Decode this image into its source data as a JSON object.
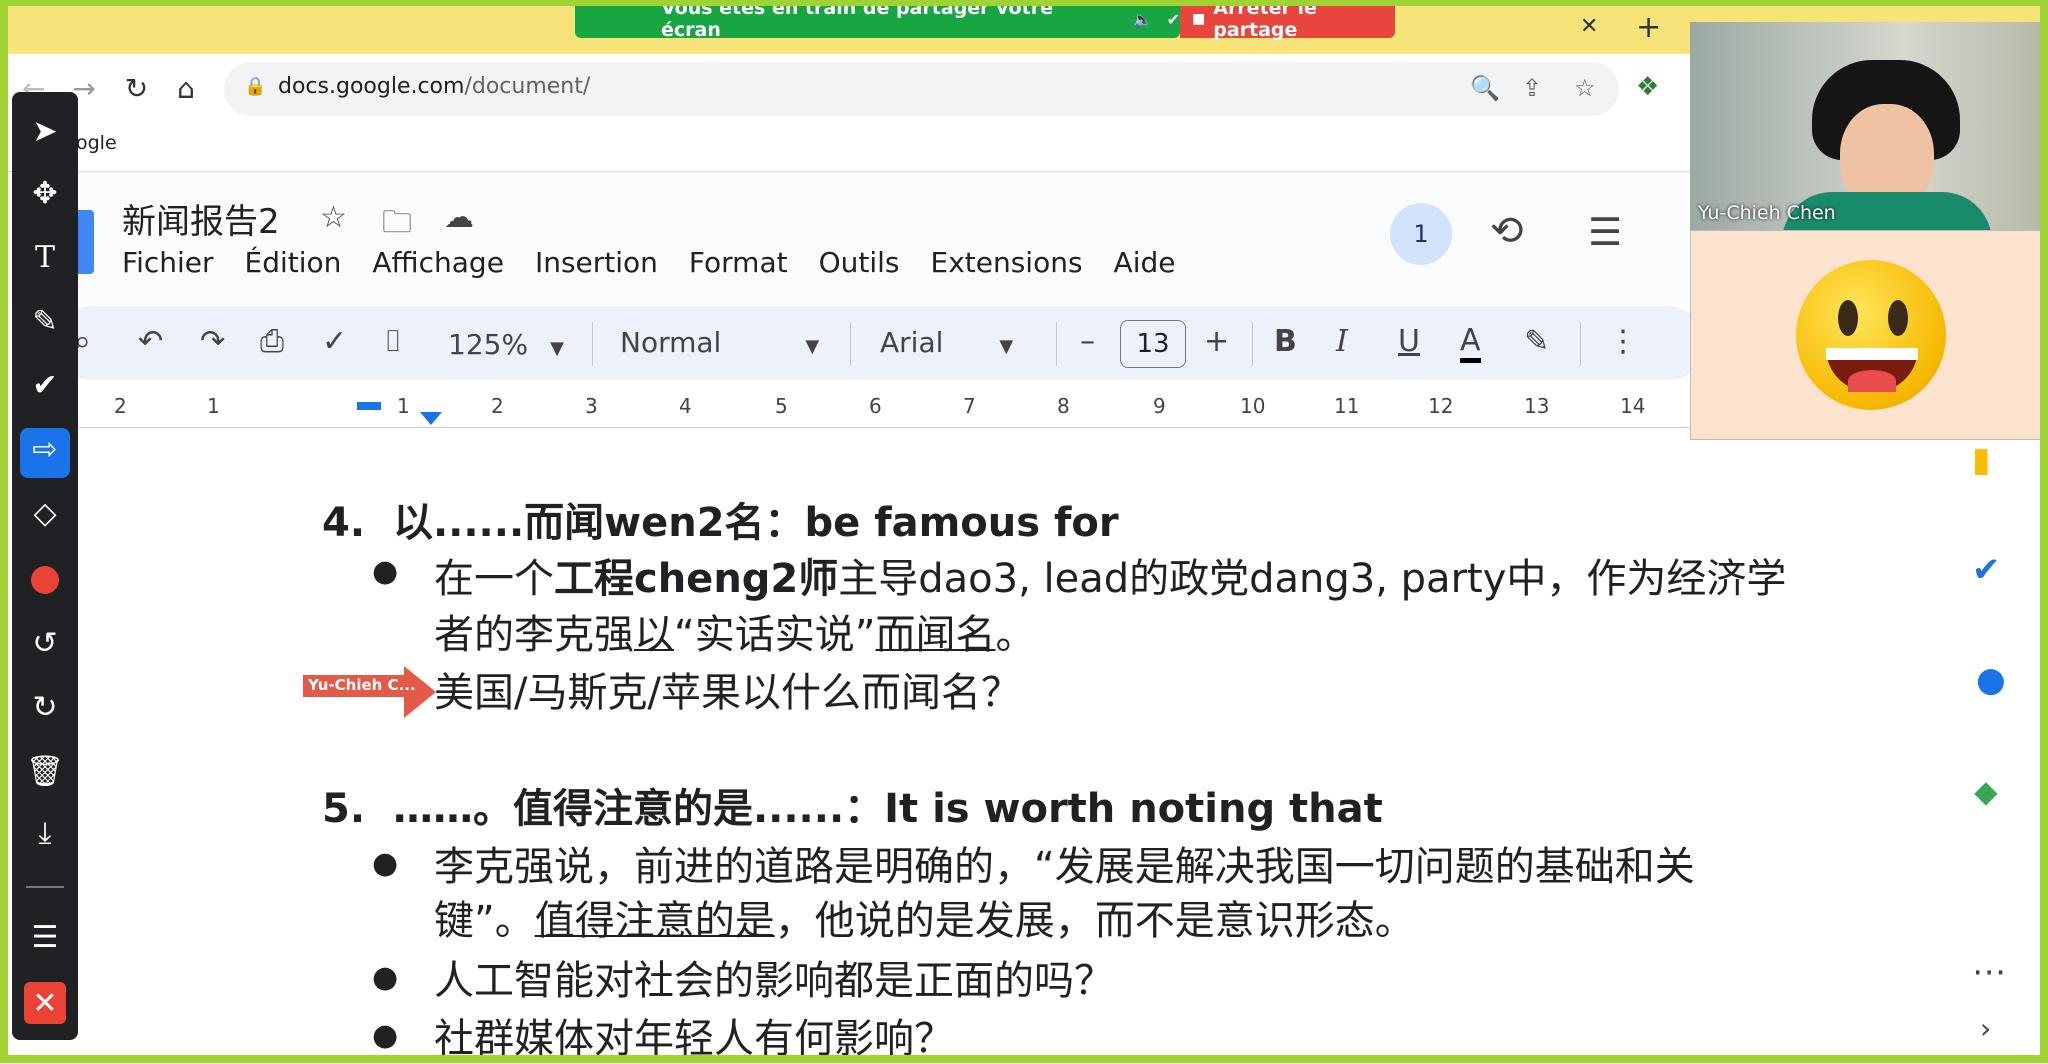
{
  "screen_share": {
    "message": "Vous êtes en train de partager votre écran",
    "stop_label": "Arrêter le partage"
  },
  "browser": {
    "url_host": "docs.google.com",
    "url_path": "/document/",
    "bookmark_fragment": "ogle"
  },
  "docs": {
    "title": "新闻报告2",
    "menu": [
      "Fichier",
      "Édition",
      "Affichage",
      "Insertion",
      "Format",
      "Outils",
      "Extensions",
      "Aide"
    ],
    "collaborator_count": "1",
    "toolbar": {
      "zoom": "125%",
      "style": "Normal",
      "font": "Arial",
      "font_size": "13",
      "bold": "B",
      "italic": "I",
      "underline": "U",
      "text_color": "A"
    },
    "ruler_labels": [
      "2",
      "1",
      "1",
      "2",
      "3",
      "4",
      "5",
      "6",
      "7",
      "8",
      "9",
      "10",
      "11",
      "12",
      "13",
      "14"
    ]
  },
  "document": {
    "item4": {
      "number": "4.",
      "heading": "以......而闻wen2名：be famous for",
      "b1_line1_plain1": "在一个",
      "b1_line1_bold": "工程cheng2师",
      "b1_line1_plain2": "主导dao3, lead的政党dang3, party中，作为经济学",
      "b1_line2_a": "者的李克强",
      "b1_line2_u1": "以",
      "b1_line2_b": "“实话实说”",
      "b1_line2_u2": "而闻名",
      "b1_line2_c": "。",
      "b2": "美国/马斯克/苹果以什么而闻名？"
    },
    "item5": {
      "number": "5.",
      "heading": "……。值得注意的是......：It is worth noting that",
      "b1_line1": "李克强说，前进的道路是明确的，“发展是解决我国一切问题的基础和关",
      "b1_line2_a": "键”。",
      "b1_line2_u": "值得注意的是",
      "b1_line2_b": "，他说的是发展，而不是意识形态。",
      "b2": "人工智能对社会的影响都是正面的吗？",
      "b3": "社群媒体对年轻人有何影响？"
    }
  },
  "pointer_label": "Yu-Chieh C...",
  "participants": [
    {
      "name": "Yu-Chieh Chen"
    }
  ],
  "colors": {
    "share_green": "#18a642",
    "stop_red": "#e8453c",
    "frame_green": "#9fd334",
    "tab_yellow": "#f6e37a",
    "docs_blue": "#1a73e8"
  }
}
